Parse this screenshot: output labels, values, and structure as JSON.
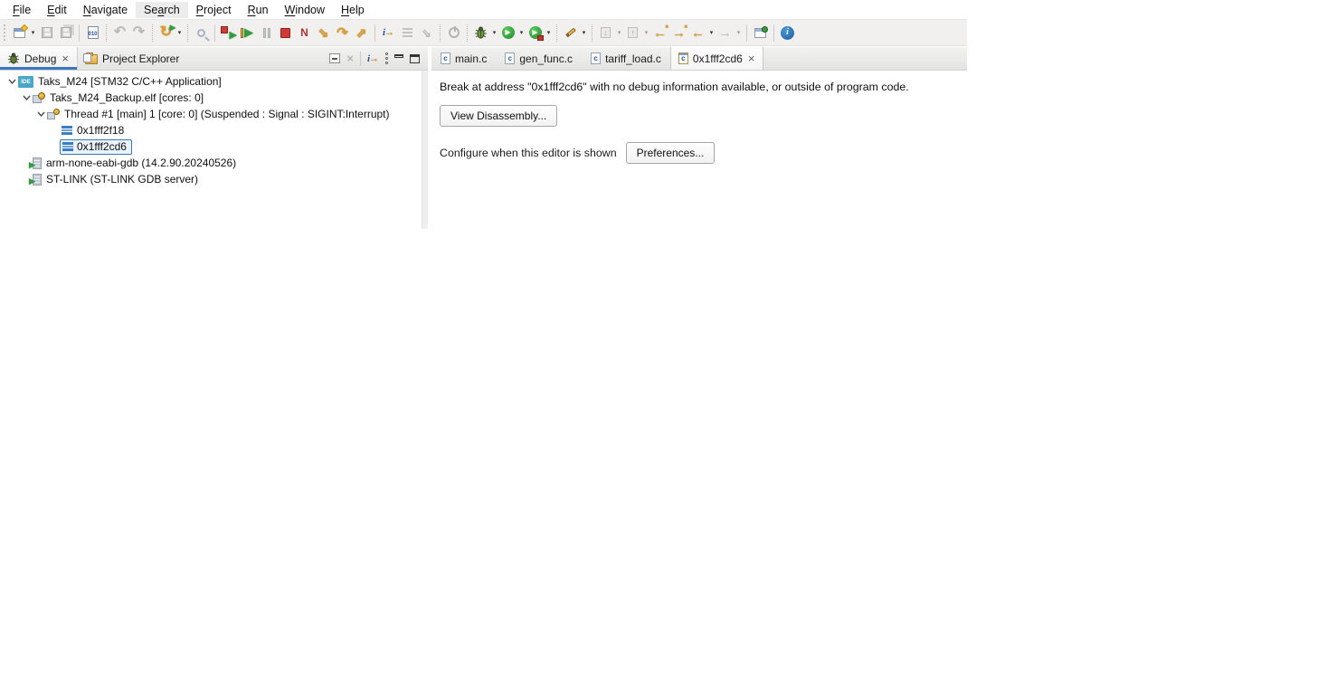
{
  "menubar": {
    "items": [
      {
        "pre": "",
        "key": "F",
        "post": "ile"
      },
      {
        "pre": "",
        "key": "E",
        "post": "dit"
      },
      {
        "pre": "",
        "key": "N",
        "post": "avigate"
      },
      {
        "pre": "Se",
        "key": "a",
        "post": "rch"
      },
      {
        "pre": "",
        "key": "P",
        "post": "roject"
      },
      {
        "pre": "",
        "key": "R",
        "post": "un"
      },
      {
        "pre": "",
        "key": "W",
        "post": "indow"
      },
      {
        "pre": "",
        "key": "H",
        "post": "elp"
      }
    ]
  },
  "icons": {
    "caret": "▾",
    "close": "×",
    "undo": "↶",
    "redo": "↷",
    "refresh": "↻",
    "play": "▶",
    "binary": "010",
    "disconnect": "N",
    "arrow_left": "←",
    "arrow_right": "→",
    "arrow_up": "↑",
    "arrow_down": "↓",
    "asterisk": "*",
    "step_into": "⇘",
    "step_over": "↷",
    "step_return": "⇗",
    "instruction_i": "i",
    "instruction_arrow": "→",
    "info_i": "i",
    "ide_badge": "IDE",
    "c_letter": "c"
  },
  "debug_view": {
    "tabs": [
      {
        "label": "Debug"
      },
      {
        "label": "Project Explorer"
      }
    ],
    "tree": {
      "rows": [
        {
          "label": "Taks_M24 [STM32 C/C++ Application]"
        },
        {
          "label": "Taks_M24_Backup.elf [cores: 0]"
        },
        {
          "label": "Thread #1 [main] 1 [core: 0] (Suspended : Signal : SIGINT:Interrupt)"
        },
        {
          "label": "0x1fff2f18"
        },
        {
          "label": "0x1fff2cd6"
        },
        {
          "label": "arm-none-eabi-gdb (14.2.90.20240526)"
        },
        {
          "label": "ST-LINK (ST-LINK GDB server)"
        }
      ]
    }
  },
  "editor": {
    "tabs": [
      {
        "label": "main.c"
      },
      {
        "label": "gen_func.c"
      },
      {
        "label": "tariff_load.c"
      },
      {
        "label": "0x1fff2cd6"
      }
    ],
    "message": "Break at address \"0x1fff2cd6\" with no debug information available, or outside of program code.",
    "view_disassembly_label": "View Disassembly...",
    "configure_text": "Configure when this editor is shown",
    "preferences_label": "Preferences..."
  },
  "colors": {
    "accent_blue": "#3b76c0",
    "selection_border": "#3979b9",
    "terminate_red": "#d23b35",
    "run_green": "#2f9e3d",
    "step_gold": "#dc9f33",
    "info_blue": "#1d5f9e",
    "ide_badge_teal": "#4aa6c9"
  }
}
